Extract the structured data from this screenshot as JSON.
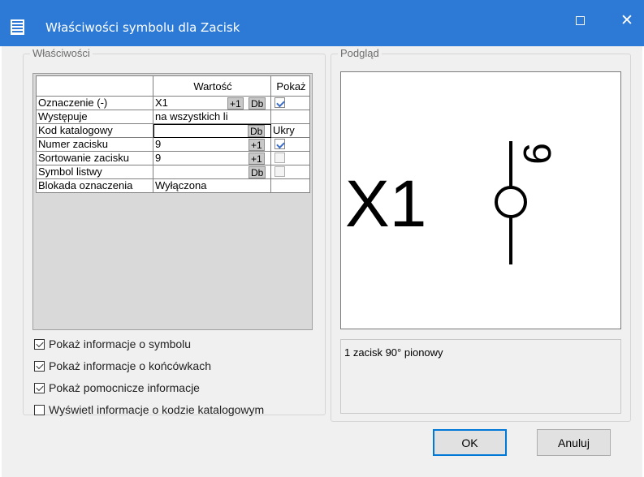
{
  "window": {
    "title": "Właściwości symbolu dla Zacisk"
  },
  "properties": {
    "group_label": "Właściwości",
    "headers": {
      "value": "Wartość",
      "show": "Pokaż"
    },
    "rows": [
      {
        "name": "Oznaczenie (-)",
        "value": "X1",
        "buttons": [
          "+1",
          "Db"
        ],
        "show": "checked"
      },
      {
        "name": "Występuje",
        "value": "na wszystkich li",
        "buttons": [],
        "show": "none"
      },
      {
        "name": "Kod katalogowy",
        "value": "",
        "buttons": [
          "Db"
        ],
        "show_text": "Ukry"
      },
      {
        "name": "Numer zacisku",
        "value": "9",
        "buttons": [
          "+1"
        ],
        "show": "checked"
      },
      {
        "name": "Sortowanie zacisku",
        "value": "9",
        "buttons": [
          "+1"
        ],
        "show": "unchecked"
      },
      {
        "name": "Symbol listwy",
        "value": "",
        "buttons": [
          "Db"
        ],
        "show": "unchecked"
      },
      {
        "name": "Blokada oznaczenia",
        "value": "Wyłączona",
        "buttons": [],
        "show": "none"
      }
    ]
  },
  "options": [
    {
      "label": "Pokaż informacje o symbolu",
      "checked": true
    },
    {
      "label": "Pokaż informacje o końcówkach",
      "checked": true
    },
    {
      "label": "Pokaż pomocnicze informacje",
      "checked": true
    },
    {
      "label": "Wyświetl informacje o kodzie katalogowym",
      "checked": false
    }
  ],
  "preview": {
    "group_label": "Podgląd",
    "designation": "X1",
    "terminal_number": "9",
    "description": "1 zacisk 90° pionowy"
  },
  "buttons": {
    "ok": "OK",
    "cancel": "Anuluj"
  },
  "colors": {
    "titlebar": "#2c7ad6",
    "background": "#f0f0f0",
    "accent": "#0078d7"
  }
}
